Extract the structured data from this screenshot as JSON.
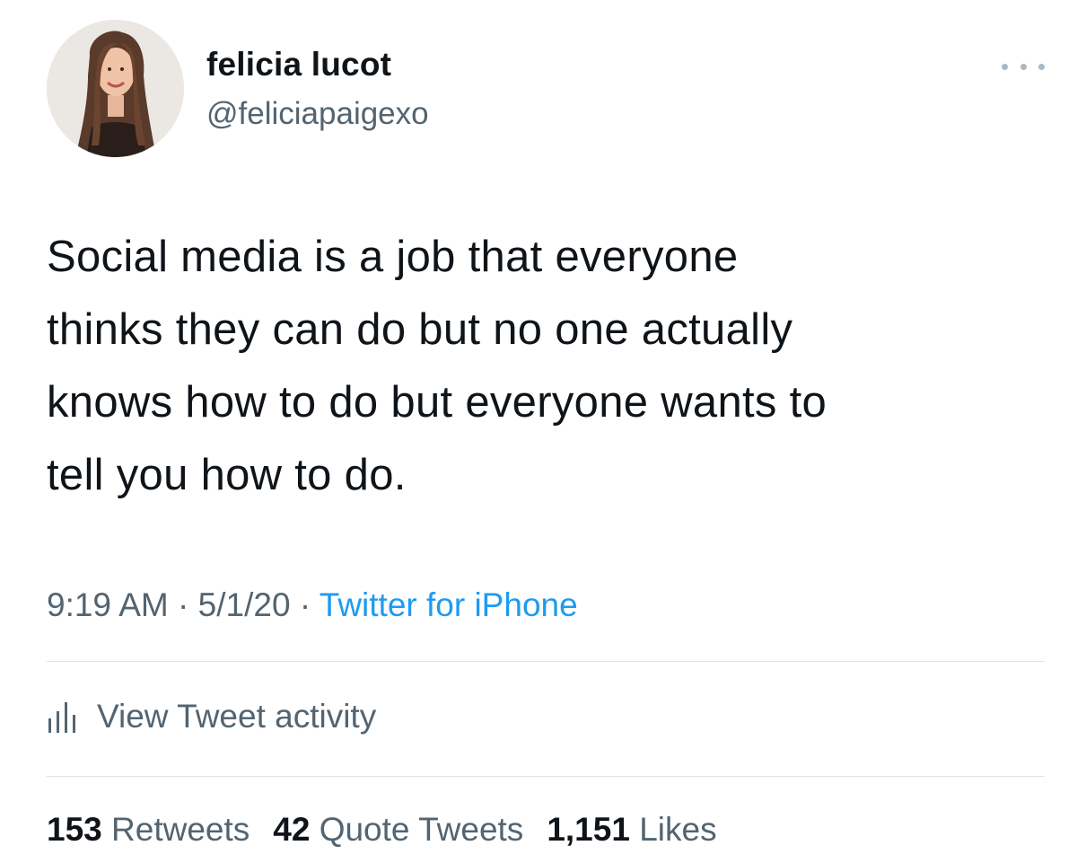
{
  "author": {
    "display_name": "felicia lucot",
    "handle": "@feliciapaigexo",
    "avatar_icon": "profile-photo"
  },
  "more_icon": "ellipsis-icon",
  "tweet": {
    "text": "Social media is a job that everyone\nthinks they can do but no one actually\nknows how to do but everyone wants to\ntell you how to do."
  },
  "meta": {
    "time": "9:19 AM",
    "separator": "·",
    "date": "5/1/20",
    "source": "Twitter for iPhone"
  },
  "activity": {
    "icon": "bar-chart-icon",
    "label": "View Tweet activity"
  },
  "stats": {
    "retweets_count": "153",
    "retweets_label": "Retweets",
    "quotes_count": "42",
    "quotes_label": "Quote Tweets",
    "likes_count": "1,151",
    "likes_label": "Likes"
  },
  "colors": {
    "text": "#0f1419",
    "secondary": "#536471",
    "link": "#1d9bf0",
    "divider": "#dfe3e6"
  }
}
